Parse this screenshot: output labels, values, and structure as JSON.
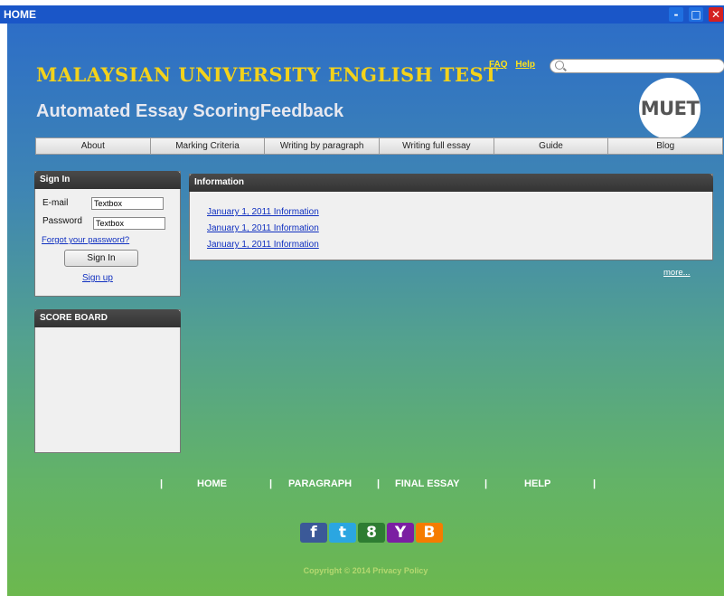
{
  "window": {
    "title": "HOME",
    "min_label": "-",
    "max_label": "□",
    "close_label": "✕"
  },
  "header": {
    "title": "MALAYSIAN UNIVERSITY ENGLISH TEST",
    "subtitle": "Automated Essay ScoringFeedback",
    "faq": "FAQ",
    "help": "Help",
    "badge": "MUET",
    "search_placeholder": ""
  },
  "nav": [
    "About",
    "Marking Criteria",
    "Writing by paragraph",
    "Writing full essay",
    "Guide",
    "Blog"
  ],
  "signin": {
    "title": "Sign In",
    "email_label": "E-mail",
    "email_value": "Textbox",
    "password_label": "Password",
    "password_value": "Textbox",
    "forgot": "Forgot your password?",
    "button": "Sign In",
    "signup": "Sign up"
  },
  "scoreboard": {
    "title": "SCORE BOARD"
  },
  "information": {
    "title": "Information",
    "items": [
      "January 1, 2011  Information",
      "January 1, 2011  Information",
      "January 1, 2011  Information"
    ],
    "more": "more..."
  },
  "footer": {
    "sep": "|",
    "links": [
      "HOME",
      "PARAGRAPH",
      "FINAL ESSAY",
      "HELP"
    ],
    "social": [
      {
        "icon": "facebook-icon",
        "glyph": "f",
        "color": "#3b5998"
      },
      {
        "icon": "twitter-icon",
        "glyph": "t",
        "color": "#2ba6e1"
      },
      {
        "icon": "google-plus-icon",
        "glyph": "8",
        "color": "#2e7d32"
      },
      {
        "icon": "yahoo-icon",
        "glyph": "Y",
        "color": "#7b1fa2"
      },
      {
        "icon": "blogger-icon",
        "glyph": "B",
        "color": "#f57c00"
      }
    ],
    "copyright": "Copyright © 2014   Privacy Policy"
  },
  "colors": {
    "titlebar": "#1a56c8",
    "brand_yellow": "#f3d21b",
    "link_blue": "#1030c0"
  }
}
